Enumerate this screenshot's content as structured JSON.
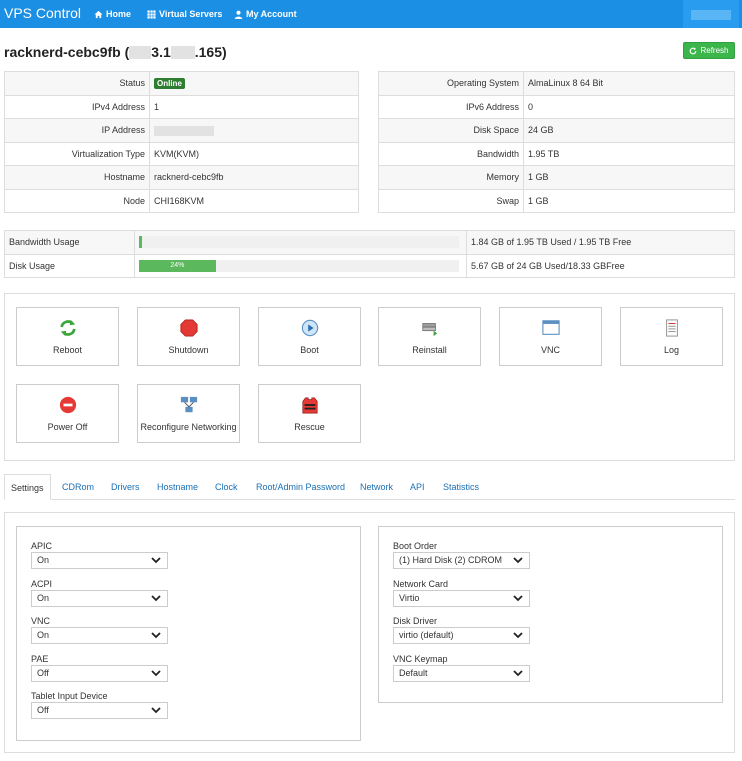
{
  "navbar": {
    "brand": "VPS Control",
    "items": [
      {
        "label": "Home",
        "icon": "home-icon"
      },
      {
        "label": "Virtual Servers",
        "icon": "grid-icon"
      },
      {
        "label": "My Account",
        "icon": "user-icon"
      }
    ]
  },
  "header": {
    "hostname": "racknerd-cebc9fb",
    "ip_open": " (",
    "ip_part1": "3.1",
    "ip_part2": ".165)",
    "refresh_label": "Refresh"
  },
  "info_left": [
    {
      "key": "Status",
      "value": "Online"
    },
    {
      "key": "IPv4 Address",
      "value": "1"
    },
    {
      "key": "IP Address",
      "value": ""
    },
    {
      "key": "Virtualization Type",
      "value": "KVM(KVM)"
    },
    {
      "key": "Hostname",
      "value": "racknerd-cebc9fb"
    },
    {
      "key": "Node",
      "value": "CHI168KVM"
    }
  ],
  "info_right": [
    {
      "key": "Operating System",
      "value": "AlmaLinux 8 64 Bit"
    },
    {
      "key": "IPv6 Address",
      "value": "0"
    },
    {
      "key": "Disk Space",
      "value": "24 GB"
    },
    {
      "key": "Bandwidth",
      "value": "1.95 TB"
    },
    {
      "key": "Memory",
      "value": "1 GB"
    },
    {
      "key": "Swap",
      "value": "1 GB"
    }
  ],
  "usage": [
    {
      "label": "Bandwidth Usage",
      "percent": 1,
      "bar_text": "",
      "detail": "1.84 GB of 1.95 TB Used / 1.95 TB Free"
    },
    {
      "label": "Disk Usage",
      "percent": 24,
      "bar_text": "24%",
      "detail": "5.67 GB of 24 GB Used/18.33 GBFree"
    }
  ],
  "actions": [
    {
      "label": "Reboot",
      "icon": "reboot-icon"
    },
    {
      "label": "Shutdown",
      "icon": "shutdown-icon"
    },
    {
      "label": "Boot",
      "icon": "boot-icon"
    },
    {
      "label": "Reinstall",
      "icon": "reinstall-icon"
    },
    {
      "label": "VNC",
      "icon": "vnc-icon"
    },
    {
      "label": "Log",
      "icon": "log-icon"
    },
    {
      "label": "Power Off",
      "icon": "power-off-icon"
    },
    {
      "label": "Reconfigure Networking",
      "icon": "network-icon"
    },
    {
      "label": "Rescue",
      "icon": "rescue-icon"
    }
  ],
  "tabs": [
    {
      "label": "Settings",
      "active": true
    },
    {
      "label": "CDRom"
    },
    {
      "label": "Drivers"
    },
    {
      "label": "Hostname"
    },
    {
      "label": "Clock"
    },
    {
      "label": "Root/Admin Password"
    },
    {
      "label": "Network"
    },
    {
      "label": "API"
    },
    {
      "label": "Statistics"
    }
  ],
  "settings_left": [
    {
      "label": "APIC",
      "value": "On"
    },
    {
      "label": "ACPI",
      "value": "On"
    },
    {
      "label": "VNC",
      "value": "On"
    },
    {
      "label": "PAE",
      "value": "Off"
    },
    {
      "label": "Tablet Input Device",
      "value": "Off"
    }
  ],
  "settings_right": [
    {
      "label": "Boot Order",
      "value": "(1) Hard Disk (2) CDROM"
    },
    {
      "label": "Network Card",
      "value": "Virtio"
    },
    {
      "label": "Disk Driver",
      "value": "virtio (default)"
    },
    {
      "label": "VNC Keymap",
      "value": "Default"
    }
  ],
  "colors": {
    "navbar": "#1a8fe3",
    "refresh": "#3cb54a",
    "online": "#2e7d32",
    "bar": "#5cb85c",
    "link": "#1a6fb5"
  }
}
